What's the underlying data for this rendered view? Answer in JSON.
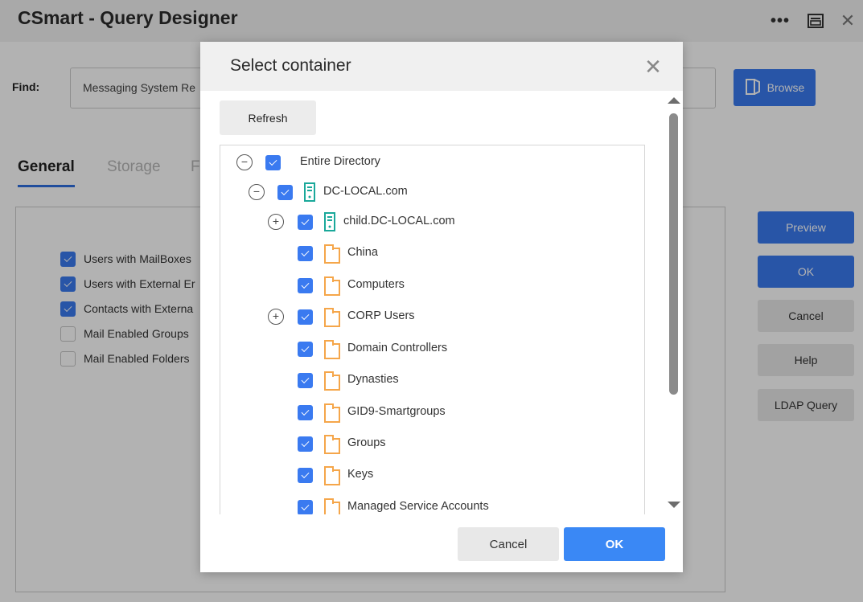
{
  "window": {
    "title": "CSmart - Query Designer",
    "more_icon": "ellipsis-icon",
    "restore_icon": "restore-window-icon",
    "close_icon": "close-icon"
  },
  "find": {
    "label": "Find:",
    "value": "Messaging System Re",
    "browse_label": "Browse"
  },
  "tabs": [
    {
      "label": "General",
      "active": true
    },
    {
      "label": "Storage",
      "active": false
    },
    {
      "label": "Fi",
      "active": false
    }
  ],
  "options": [
    {
      "label": "Users with MailBoxes",
      "checked": true
    },
    {
      "label": "Users with External Er",
      "checked": true
    },
    {
      "label": "Contacts with Externa",
      "checked": true
    },
    {
      "label": "Mail Enabled Groups",
      "checked": false
    },
    {
      "label": "Mail Enabled Folders",
      "checked": false
    }
  ],
  "side_buttons": {
    "preview": "Preview",
    "ok": "OK",
    "cancel": "Cancel",
    "help": "Help",
    "ldap": "LDAP Query"
  },
  "dialog": {
    "title": "Select container",
    "refresh_label": "Refresh",
    "cancel_label": "Cancel",
    "ok_label": "OK",
    "tree": [
      {
        "label": "Entire Directory",
        "level": 0,
        "toggle": "collapse",
        "icon": "none",
        "checked": true
      },
      {
        "label": "DC-LOCAL.com",
        "level": 1,
        "toggle": "collapse",
        "icon": "domain-server-icon",
        "checked": true
      },
      {
        "label": "child.DC-LOCAL.com",
        "level": 2,
        "toggle": "expand",
        "icon": "domain-server-icon",
        "checked": true
      },
      {
        "label": "China",
        "level": 2,
        "toggle": "none",
        "icon": "folder-icon",
        "checked": true
      },
      {
        "label": "Computers",
        "level": 2,
        "toggle": "none",
        "icon": "folder-icon",
        "checked": true
      },
      {
        "label": "CORP Users",
        "level": 2,
        "toggle": "expand",
        "icon": "folder-icon",
        "checked": true
      },
      {
        "label": "Domain Controllers",
        "level": 2,
        "toggle": "none",
        "icon": "folder-icon",
        "checked": true
      },
      {
        "label": "Dynasties",
        "level": 2,
        "toggle": "none",
        "icon": "folder-icon",
        "checked": true
      },
      {
        "label": "GID9-Smartgroups",
        "level": 2,
        "toggle": "none",
        "icon": "folder-icon",
        "checked": true
      },
      {
        "label": "Groups",
        "level": 2,
        "toggle": "none",
        "icon": "folder-icon",
        "checked": true
      },
      {
        "label": "Keys",
        "level": 2,
        "toggle": "none",
        "icon": "folder-icon",
        "checked": true
      },
      {
        "label": "Managed Service Accounts",
        "level": 2,
        "toggle": "none",
        "icon": "folder-icon",
        "checked": true
      }
    ]
  },
  "colors": {
    "accent": "#3a7af0",
    "dialog_ok": "#3a88f5",
    "server_icon": "#1aa89a",
    "folder_icon": "#f5a64a"
  }
}
